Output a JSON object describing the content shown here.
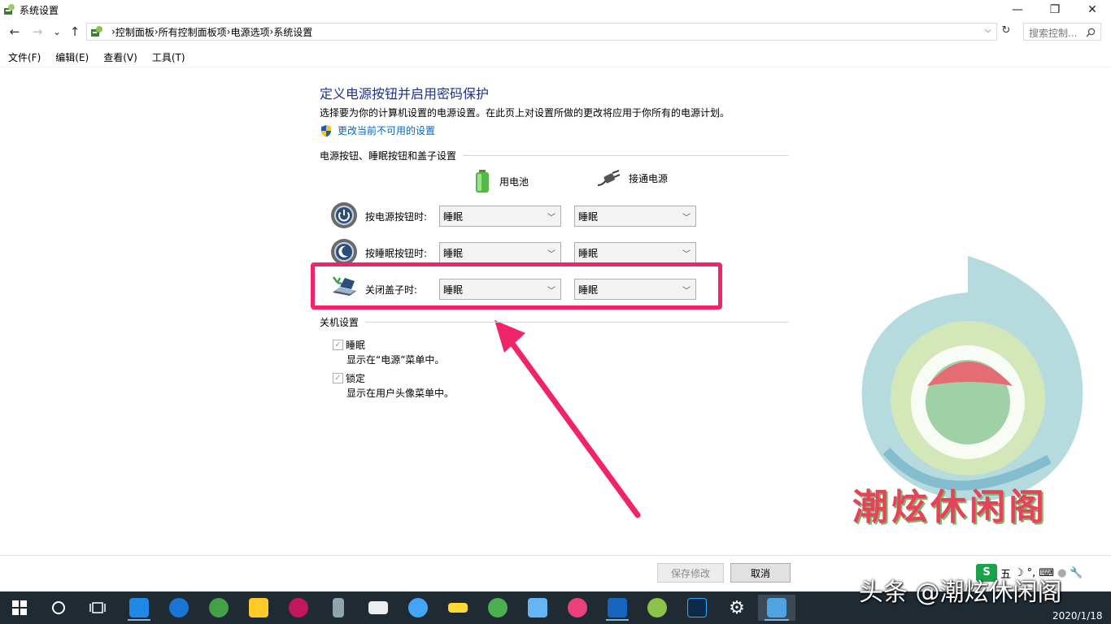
{
  "window": {
    "title": "系统设置",
    "controls": {
      "minimize": "—",
      "maximize": "❐",
      "close": "✕"
    }
  },
  "nav": {
    "back": "←",
    "forward": "→",
    "recent": "⌄",
    "up": "↑",
    "breadcrumb": [
      "控制面板",
      "所有控制面板项",
      "电源选项",
      "系统设置"
    ],
    "search_placeholder": "搜索控制...",
    "search_icon": "search-icon"
  },
  "menu": [
    "文件(F)",
    "编辑(E)",
    "查看(V)",
    "工具(T)"
  ],
  "content": {
    "heading": "定义电源按钮并启用密码保护",
    "description": "选择要为你的计算机设置的电源设置。在此页上对设置所做的更改将应用于你所有的电源计划。",
    "change_link": "更改当前不可用的设置",
    "group_buttons": "电源按钮、睡眠按钮和盖子设置",
    "col_battery": "用电池",
    "col_plugged": "接通电源",
    "rows": [
      {
        "label": "按电源按钮时:",
        "battery": "睡眠",
        "plugged": "睡眠"
      },
      {
        "label": "按睡眠按钮时:",
        "battery": "睡眠",
        "plugged": "睡眠"
      },
      {
        "label": "关闭盖子时:",
        "battery": "睡眠",
        "plugged": "睡眠"
      }
    ],
    "group_shutdown": "关机设置",
    "shutdown": [
      {
        "label": "睡眠",
        "desc": "显示在“电源”菜单中。",
        "checked": true
      },
      {
        "label": "锁定",
        "desc": "显示在用户头像菜单中。",
        "checked": true
      }
    ],
    "save": "保存修改",
    "cancel": "取消"
  },
  "watermark": "潮炫休闲阁",
  "overlay": "头条 @潮炫休闲阁",
  "ime": {
    "logo": "S",
    "mode": "五"
  },
  "taskbar": {
    "date": "2020/1/18",
    "apps": [
      "windows-start-icon",
      "cortana-icon",
      "task-view-icon",
      "maxthon-icon",
      "edge-icon",
      "browser-360-icon",
      "app-icon",
      "app-icon",
      "app-icon",
      "mail-icon",
      "app-icon",
      "app-icon",
      "wechat-icon",
      "app-icon",
      "app-icon",
      "word-icon",
      "app-icon",
      "photoshop-icon",
      "settings-icon",
      "control-panel-icon"
    ]
  },
  "colors": {
    "accent_heading": "#1e3287",
    "link": "#0066cc",
    "highlight": "#f0236b",
    "taskbar": "#1f2a33"
  }
}
